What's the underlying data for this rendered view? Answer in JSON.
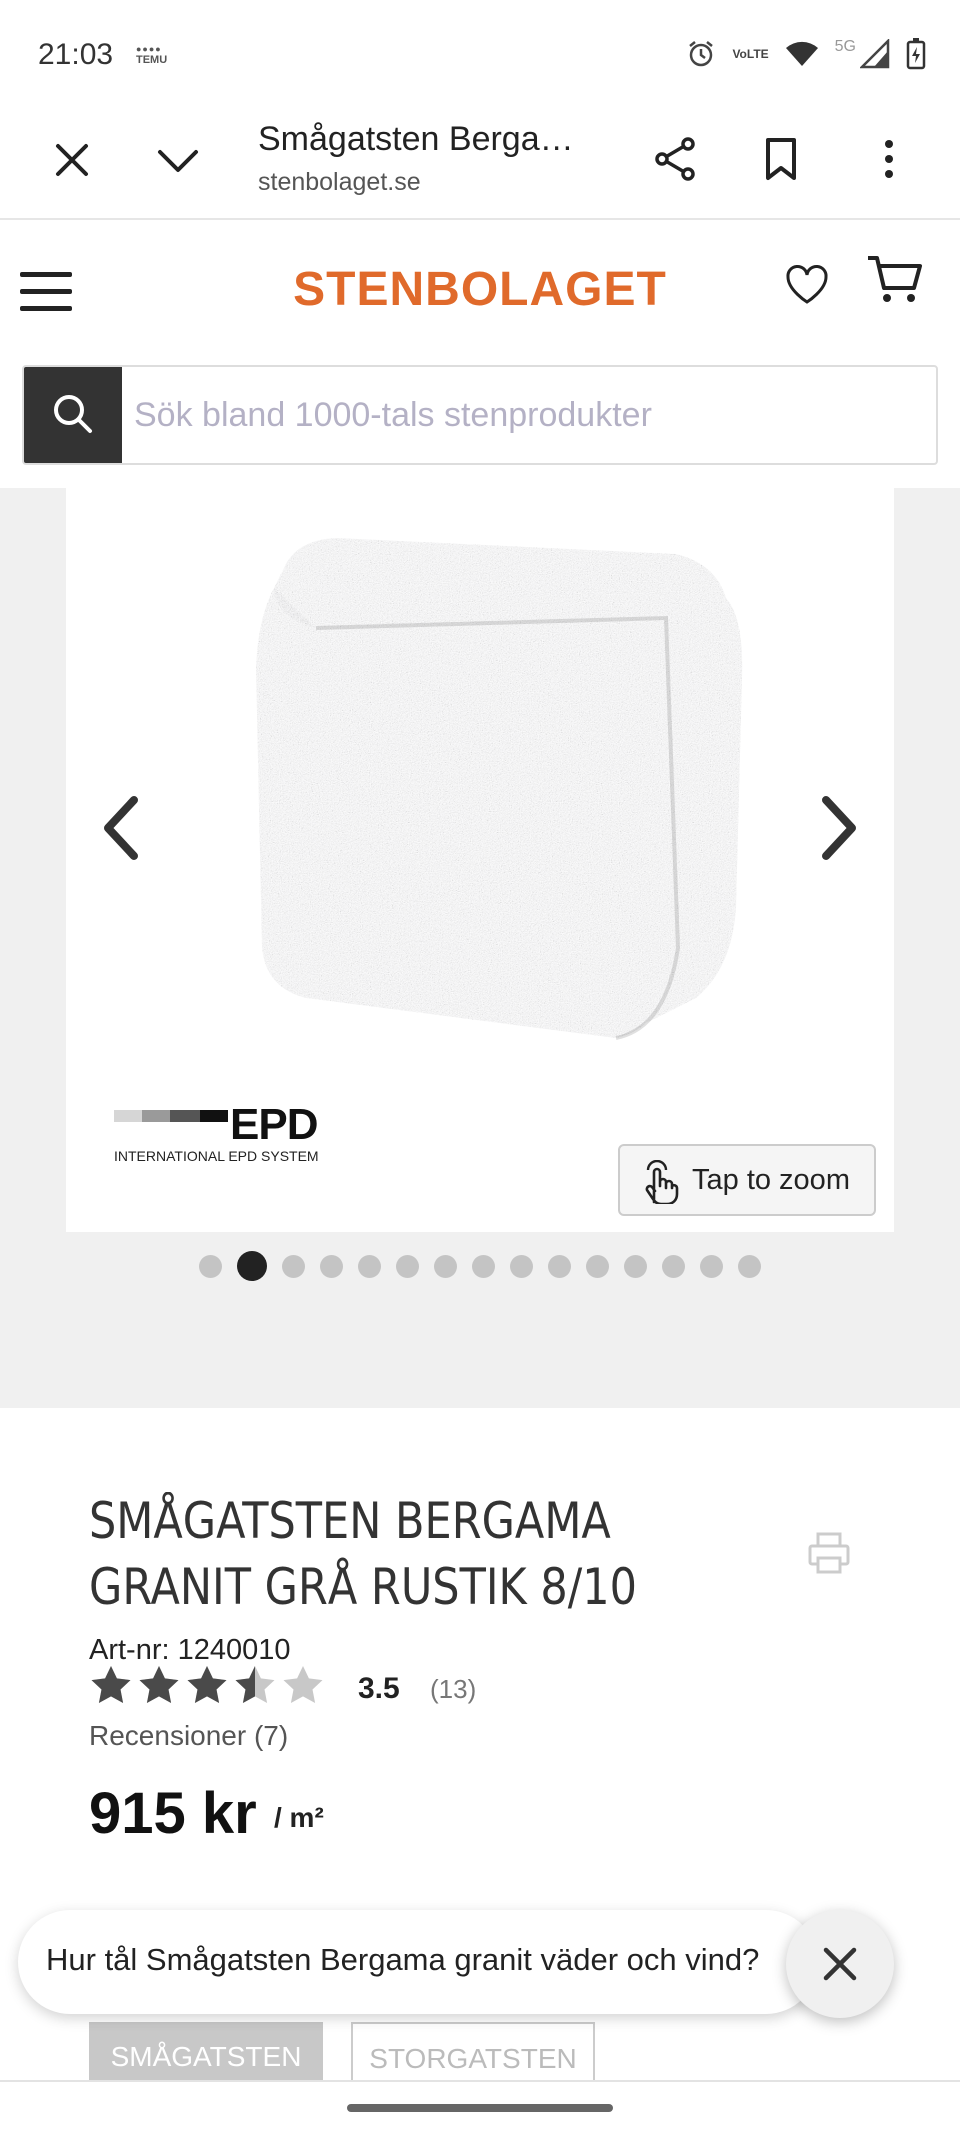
{
  "status_bar": {
    "time": "21:03",
    "notification_app": "TEMU",
    "network_badge": "VoLTE",
    "network_type": "5G",
    "icons": [
      "alarm-icon",
      "volte-icon",
      "wifi-icon",
      "signal-icon",
      "battery-charging-icon"
    ]
  },
  "browser": {
    "title": "Smågatsten Bergama granit grå rustik 8/10",
    "url": "stenbolaget.se",
    "icons": [
      "close-icon",
      "chevron-down-icon",
      "share-icon",
      "bookmark-icon",
      "more-vert-icon"
    ]
  },
  "site": {
    "logo": "STENBOLAGET",
    "accent_color": "#e06a2b",
    "icons": [
      "menu-icon",
      "heart-icon",
      "cart-icon"
    ]
  },
  "search": {
    "placeholder": "Sök bland 1000-tals stenprodukter",
    "value": ""
  },
  "gallery": {
    "epd_logo": "EPD",
    "epd_subtitle": "INTERNATIONAL EPD SYSTEM",
    "zoom_label": "Tap to zoom",
    "image_count": 15,
    "active_index": 1
  },
  "product": {
    "title": "SMÅGATSTEN BERGAMA GRANIT GRÅ RUSTIK 8/10",
    "title_line1": "SMÅGATSTEN BERGAMA",
    "title_line2": "GRANIT GRÅ RUSTIK 8/10",
    "art_nr": "Art-nr: 1240010",
    "rating": "3.5",
    "rating_value": 3.5,
    "rating_max": 5,
    "rating_count": "(13)",
    "reviews_link": "Recensioner (7)",
    "price": "915 kr",
    "unit": "/ m²",
    "options": [
      "SMÅGATSTEN",
      "STORGATSTEN"
    ]
  },
  "question_bar": {
    "text": "Hur tål Smågatsten Bergama granit väder och vind?"
  }
}
